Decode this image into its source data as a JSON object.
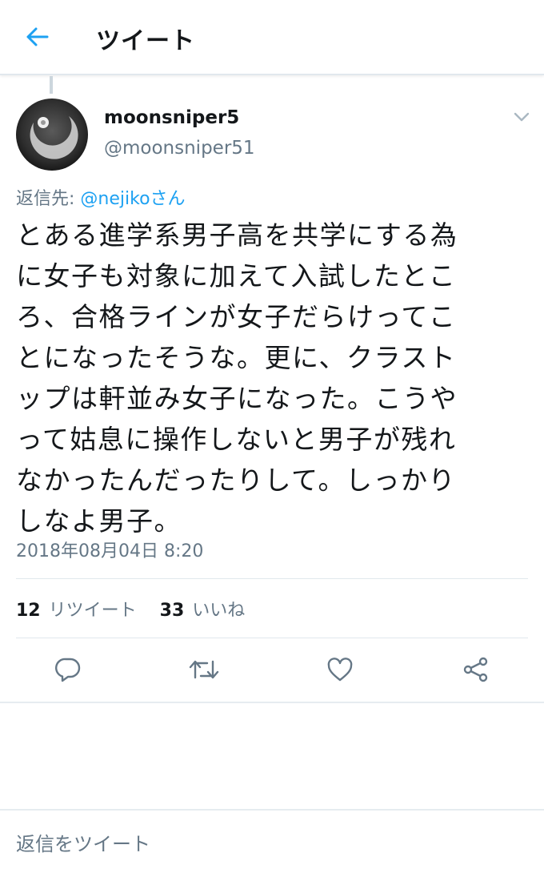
{
  "header": {
    "title": "ツイート",
    "back_icon": "back-arrow-icon"
  },
  "tweet": {
    "display_name": "moonsniper5",
    "handle": "@moonsniper51",
    "reply_to_label": "返信先:",
    "reply_to_user": "@nejikoさん",
    "text": "とある進学系男子高を共学にする為\nに女子も対象に加えて入試したとこ\nろ、合格ラインが女子だらけってこ\nとになったそうな。更に、クラスト\nップは軒並み女子になった。こうや\nって姑息に操作しないと男子が残れ\nなかったんだったりして。しっかり\nしなよ男子。",
    "timestamp": "2018年08月04日 8:20",
    "retweets": {
      "count": "12",
      "label": "リツイート"
    },
    "likes": {
      "count": "33",
      "label": "いいね"
    }
  },
  "actions": [
    "reply-icon",
    "retweet-icon",
    "like-icon",
    "share-icon"
  ],
  "reply_box": {
    "placeholder": "返信をツイート"
  },
  "colors": {
    "accent": "#1da1f2",
    "secondary_text": "#657786",
    "divider": "#e1e8ed"
  }
}
